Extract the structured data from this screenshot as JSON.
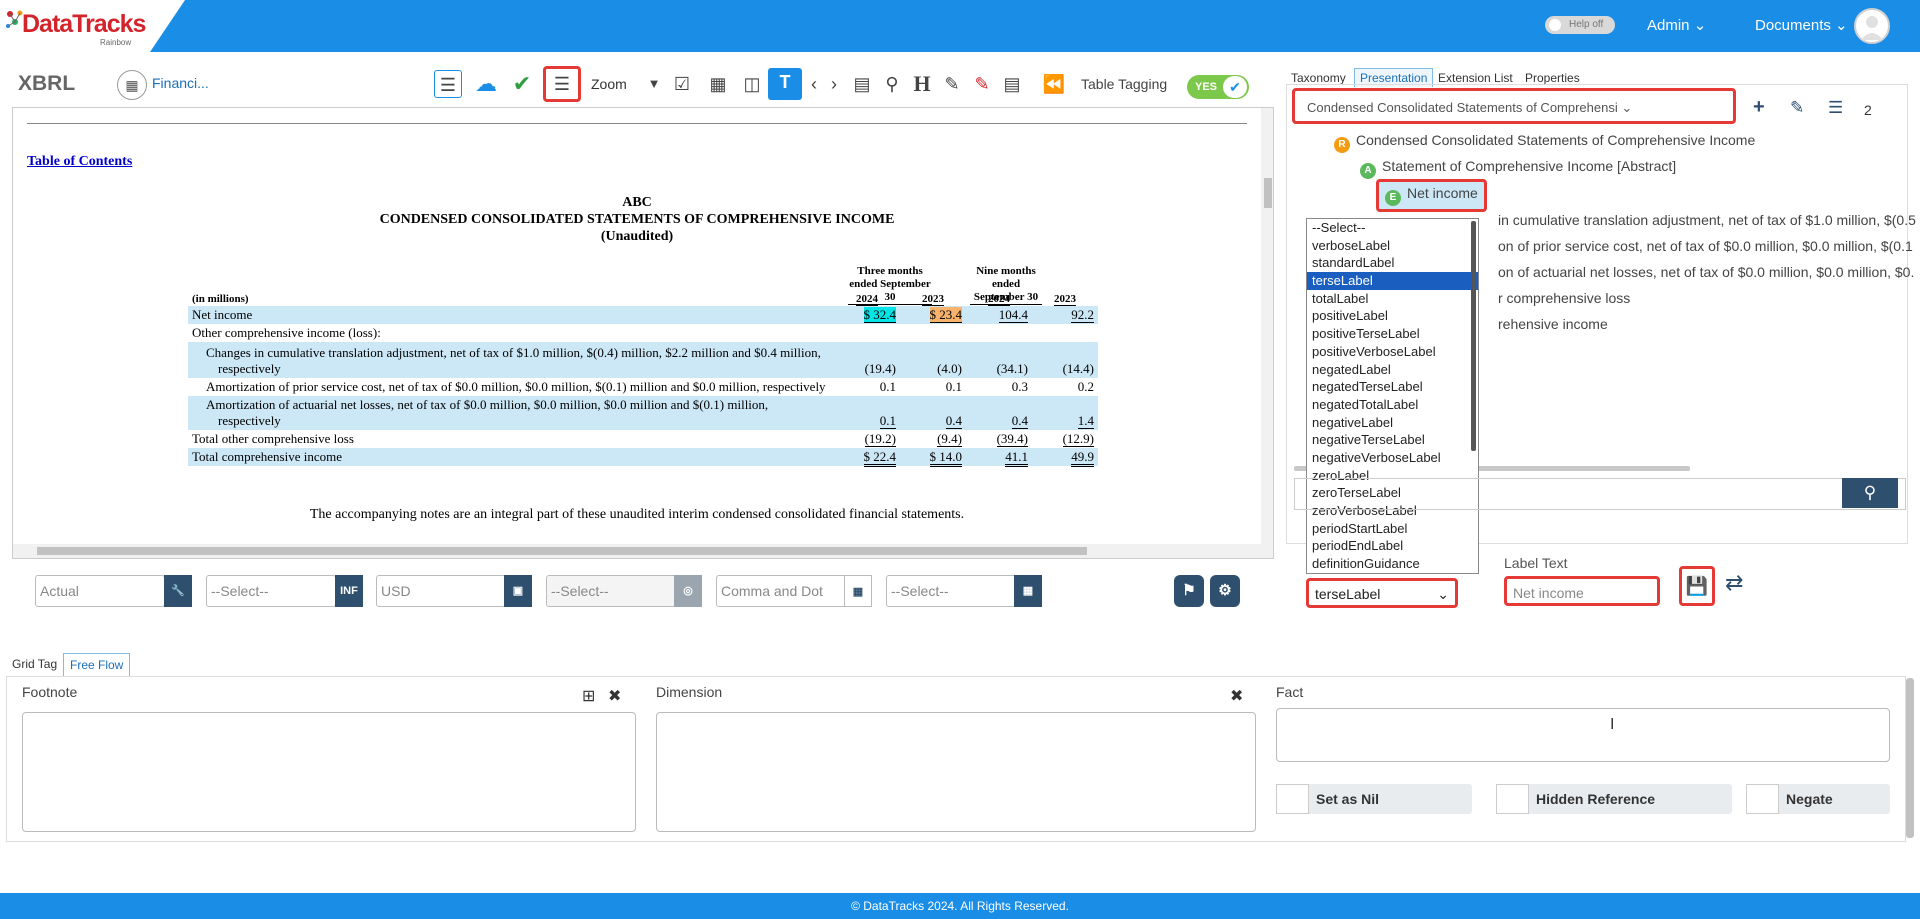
{
  "header": {
    "logo_brand": "DataTracks",
    "logo_sub": "Rainbow",
    "help_toggle": "Help off",
    "admin_menu": "Admin",
    "documents_menu": "Documents"
  },
  "toolbar": {
    "app_title": "XBRL",
    "document_name": "Financi...",
    "zoom_label": "Zoom",
    "table_tagging_label": "Table Tagging",
    "table_tagging_state": "YES"
  },
  "document": {
    "toc_link": "Table of Contents",
    "company": "ABC",
    "statement_title": "CONDENSED CONSOLIDATED STATEMENTS OF COMPREHENSIVE INCOME",
    "unaudited": "(Unaudited)",
    "col_group_1": "Three months ended September 30",
    "col_group_2": "Nine months ended September 30",
    "units_label": "(in millions)",
    "years": [
      "2024",
      "2023",
      "2024",
      "2023"
    ],
    "rows": [
      {
        "label": "Net income",
        "values": [
          "$  32.4",
          "$  23.4",
          "104.4",
          "92.2"
        ]
      },
      {
        "label": "Other comprehensive income (loss):",
        "values": [
          "",
          "",
          "",
          ""
        ]
      },
      {
        "label": "Changes in cumulative translation adjustment, net of tax of $1.0 million, $(0.4) million, $2.2 million and $0.4 million, respectively",
        "values": [
          "(19.4)",
          "(4.0)",
          "(34.1)",
          "(14.4)"
        ]
      },
      {
        "label": "Amortization of prior service cost, net of tax of $0.0 million, $0.0 million, $(0.1) million and $0.0 million, respectively",
        "values": [
          "0.1",
          "0.1",
          "0.3",
          "0.2"
        ]
      },
      {
        "label": "Amortization of actuarial net losses, net of tax of $0.0 million, $0.0 million, $0.0 million and $(0.1) million, respectively",
        "values": [
          "0.1",
          "0.4",
          "0.4",
          "1.4"
        ]
      },
      {
        "label": "Total other comprehensive loss",
        "values": [
          "(19.2)",
          "(9.4)",
          "(39.4)",
          "(12.9)"
        ]
      },
      {
        "label": "Total comprehensive income",
        "values": [
          "$  22.4",
          "$  14.0",
          "41.1",
          "49.9"
        ]
      }
    ],
    "footnote": "The accompanying notes are an integral part of these unaudited interim condensed consolidated financial statements."
  },
  "fact_inputs": {
    "period_type": "Actual",
    "period_placeholder": "--Select--",
    "period_badge": "INF",
    "unit": "USD",
    "scale_placeholder": "--Select--",
    "format": "Comma and Dot",
    "date_placeholder": "--Select--"
  },
  "right_panel": {
    "tabs": [
      "Taxonomy",
      "Presentation",
      "Extension List",
      "Properties"
    ],
    "role_select": "Condensed Consolidated Statements of Comprehensi",
    "count": "2",
    "tree": [
      {
        "badge": "R",
        "label": "Condensed Consolidated Statements of Comprehensive Income"
      },
      {
        "badge": "A",
        "label": "Statement of Comprehensive Income [Abstract]"
      },
      {
        "badge": "E",
        "label": "Net income"
      },
      {
        "badge": "",
        "label": "Changes in cumulative translation adjustment, net of tax of $1.0 million, $(0.5"
      },
      {
        "badge": "",
        "label": "Amortization of prior service cost, net of tax of $0.0 million, $0.0 million, $(0.1"
      },
      {
        "badge": "",
        "label": "Amortization of actuarial net losses, net of tax of $0.0 million, $0.0 million, $0."
      },
      {
        "badge": "",
        "label": "Total other comprehensive loss"
      },
      {
        "badge": "",
        "label": "Total comprehensive income"
      }
    ],
    "tree_visible_fragments": [
      "in cumulative translation adjustment, net of tax of $1.0 million, $(0.5",
      "on of prior service cost, net of tax of $0.0 million, $0.0 million, $(0.1",
      "on of actuarial net losses, net of tax of $0.0 million, $0.0 million, $0.",
      "r comprehensive loss",
      "rehensive income"
    ],
    "label_options": [
      "--Select--",
      "verboseLabel",
      "standardLabel",
      "terseLabel",
      "totalLabel",
      "positiveLabel",
      "positiveTerseLabel",
      "positiveVerboseLabel",
      "negatedLabel",
      "negatedTerseLabel",
      "negatedTotalLabel",
      "negativeLabel",
      "negativeTerseLabel",
      "negativeVerboseLabel",
      "zeroLabel",
      "zeroTerseLabel",
      "zeroVerboseLabel",
      "periodStartLabel",
      "periodEndLabel",
      "definitionGuidance"
    ],
    "selected_label_type": "terseLabel",
    "label_text_title": "Label Text",
    "label_text_value": "Net income"
  },
  "lower": {
    "tabs": [
      "Grid Tag",
      "Free Flow"
    ],
    "footnote_title": "Footnote",
    "dimension_title": "Dimension",
    "fact_title": "Fact",
    "set_as_nil": "Set as Nil",
    "hidden_reference": "Hidden Reference",
    "negate": "Negate"
  },
  "footer": {
    "text": "© DataTracks 2024. All Rights Reserved."
  }
}
